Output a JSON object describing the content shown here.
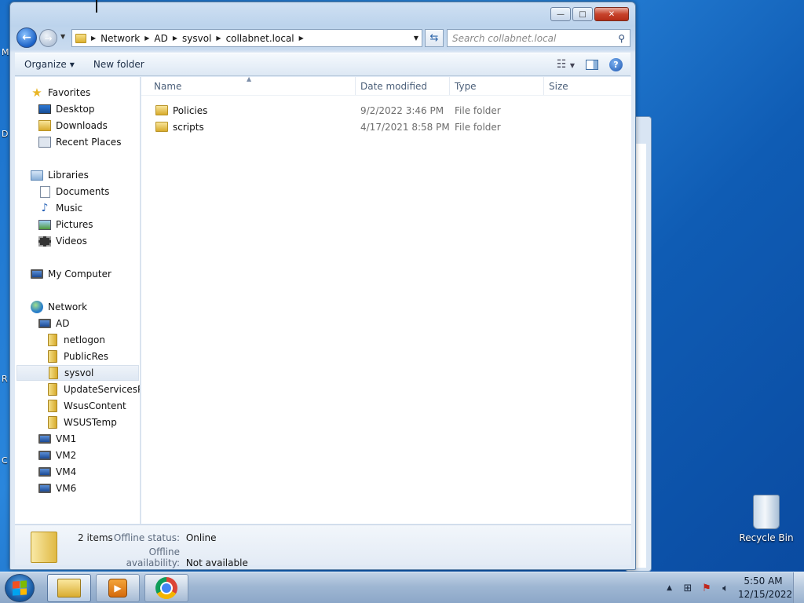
{
  "desktop_edge_letters": [
    "M",
    "D",
    "R",
    "C"
  ],
  "window": {
    "controls": {
      "minimize": "—",
      "maximize": "□",
      "close": "✕"
    }
  },
  "nav": {
    "back_glyph": "←",
    "forward_glyph": "→",
    "breadcrumbs": [
      "Network",
      "AD",
      "sysvol",
      "collabnet.local"
    ],
    "search_placeholder": "Search collabnet.local"
  },
  "command_bar": {
    "organize": "Organize",
    "new_folder": "New folder"
  },
  "sidebar": {
    "favorites": {
      "label": "Favorites",
      "items": [
        "Desktop",
        "Downloads",
        "Recent Places"
      ]
    },
    "libraries": {
      "label": "Libraries",
      "items": [
        "Documents",
        "Music",
        "Pictures",
        "Videos"
      ]
    },
    "computer": {
      "label": "My Computer"
    },
    "network": {
      "label": "Network",
      "host": "AD",
      "shares": [
        "netlogon",
        "PublicRes",
        "sysvol",
        "UpdateServicesPackages",
        "WsusContent",
        "WSUSTemp"
      ],
      "selected_share": "sysvol",
      "machines": [
        "VM1",
        "VM2",
        "VM4",
        "VM6"
      ]
    }
  },
  "columns": {
    "name": "Name",
    "date": "Date modified",
    "type": "Type",
    "size": "Size"
  },
  "files": [
    {
      "name": "Policies",
      "date": "9/2/2022 3:46 PM",
      "type": "File folder",
      "size": ""
    },
    {
      "name": "scripts",
      "date": "4/17/2021 8:58 PM",
      "type": "File folder",
      "size": ""
    }
  ],
  "details": {
    "count": "2 items",
    "offline_status_label": "Offline status:",
    "offline_status_value": "Online",
    "offline_avail_label": "Offline availability:",
    "offline_avail_value": "Not available"
  },
  "taskbar": {
    "time": "5:50 AM",
    "date": "12/15/2022"
  },
  "desktop": {
    "recycle_bin": "Recycle Bin"
  }
}
